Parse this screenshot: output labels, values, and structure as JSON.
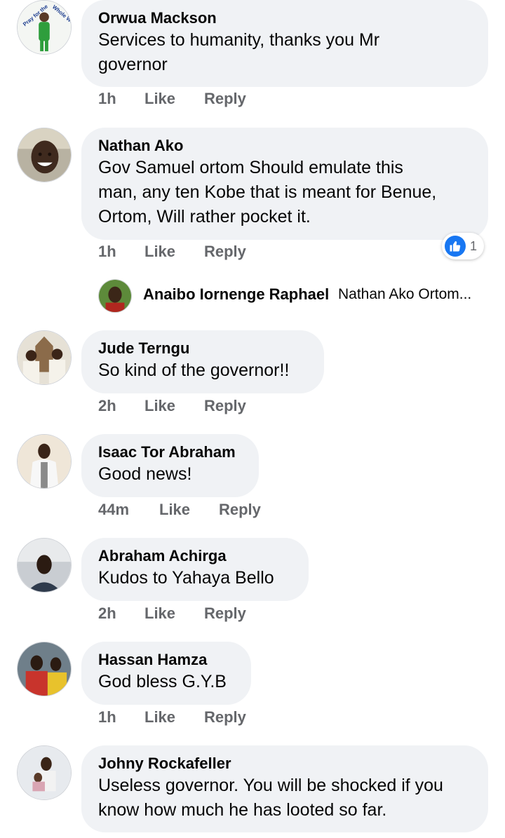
{
  "comments": [
    {
      "author": "Orwua Mackson",
      "text_lines": [
        "Services to humanity, thanks you Mr",
        "governor"
      ],
      "time": "1h",
      "like": "Like",
      "reply": "Reply",
      "avatar_text": "Pray for the Whole World"
    },
    {
      "author": "Nathan Ako",
      "text_lines": [
        "Gov Samuel ortom Should emulate this",
        "man, any ten Kobe that is meant for Benue,",
        "Ortom, Will rather pocket it."
      ],
      "time": "1h",
      "like": "Like",
      "reply": "Reply",
      "reaction_count": "1"
    },
    {
      "author": "Jude Terngu",
      "text_lines": [
        "So kind of the governor!!"
      ],
      "time": "2h",
      "like": "Like",
      "reply": "Reply"
    },
    {
      "author": "Isaac Tor Abraham",
      "text_lines": [
        "Good news!"
      ],
      "time": "44m",
      "like": "Like",
      "reply": "Reply"
    },
    {
      "author": "Abraham Achirga",
      "text_lines": [
        "Kudos to Yahaya Bello"
      ],
      "time": "2h",
      "like": "Like",
      "reply": "Reply"
    },
    {
      "author": "Hassan Hamza",
      "text_lines": [
        "God bless G.Y.B"
      ],
      "time": "1h",
      "like": "Like",
      "reply": "Reply"
    },
    {
      "author": "Johny Rockafeller",
      "text_lines": [
        "Useless governor. You will be shocked if you",
        "know how much he has looted so far."
      ]
    }
  ],
  "reply_preview": {
    "author": "Anaibo Iornenge Raphael",
    "snippet": "Nathan Ako Ortom..."
  },
  "colors": {
    "bubble": "#f0f2f5",
    "meta": "#65676b",
    "like_blue": "#1877f2",
    "text": "#050505"
  }
}
